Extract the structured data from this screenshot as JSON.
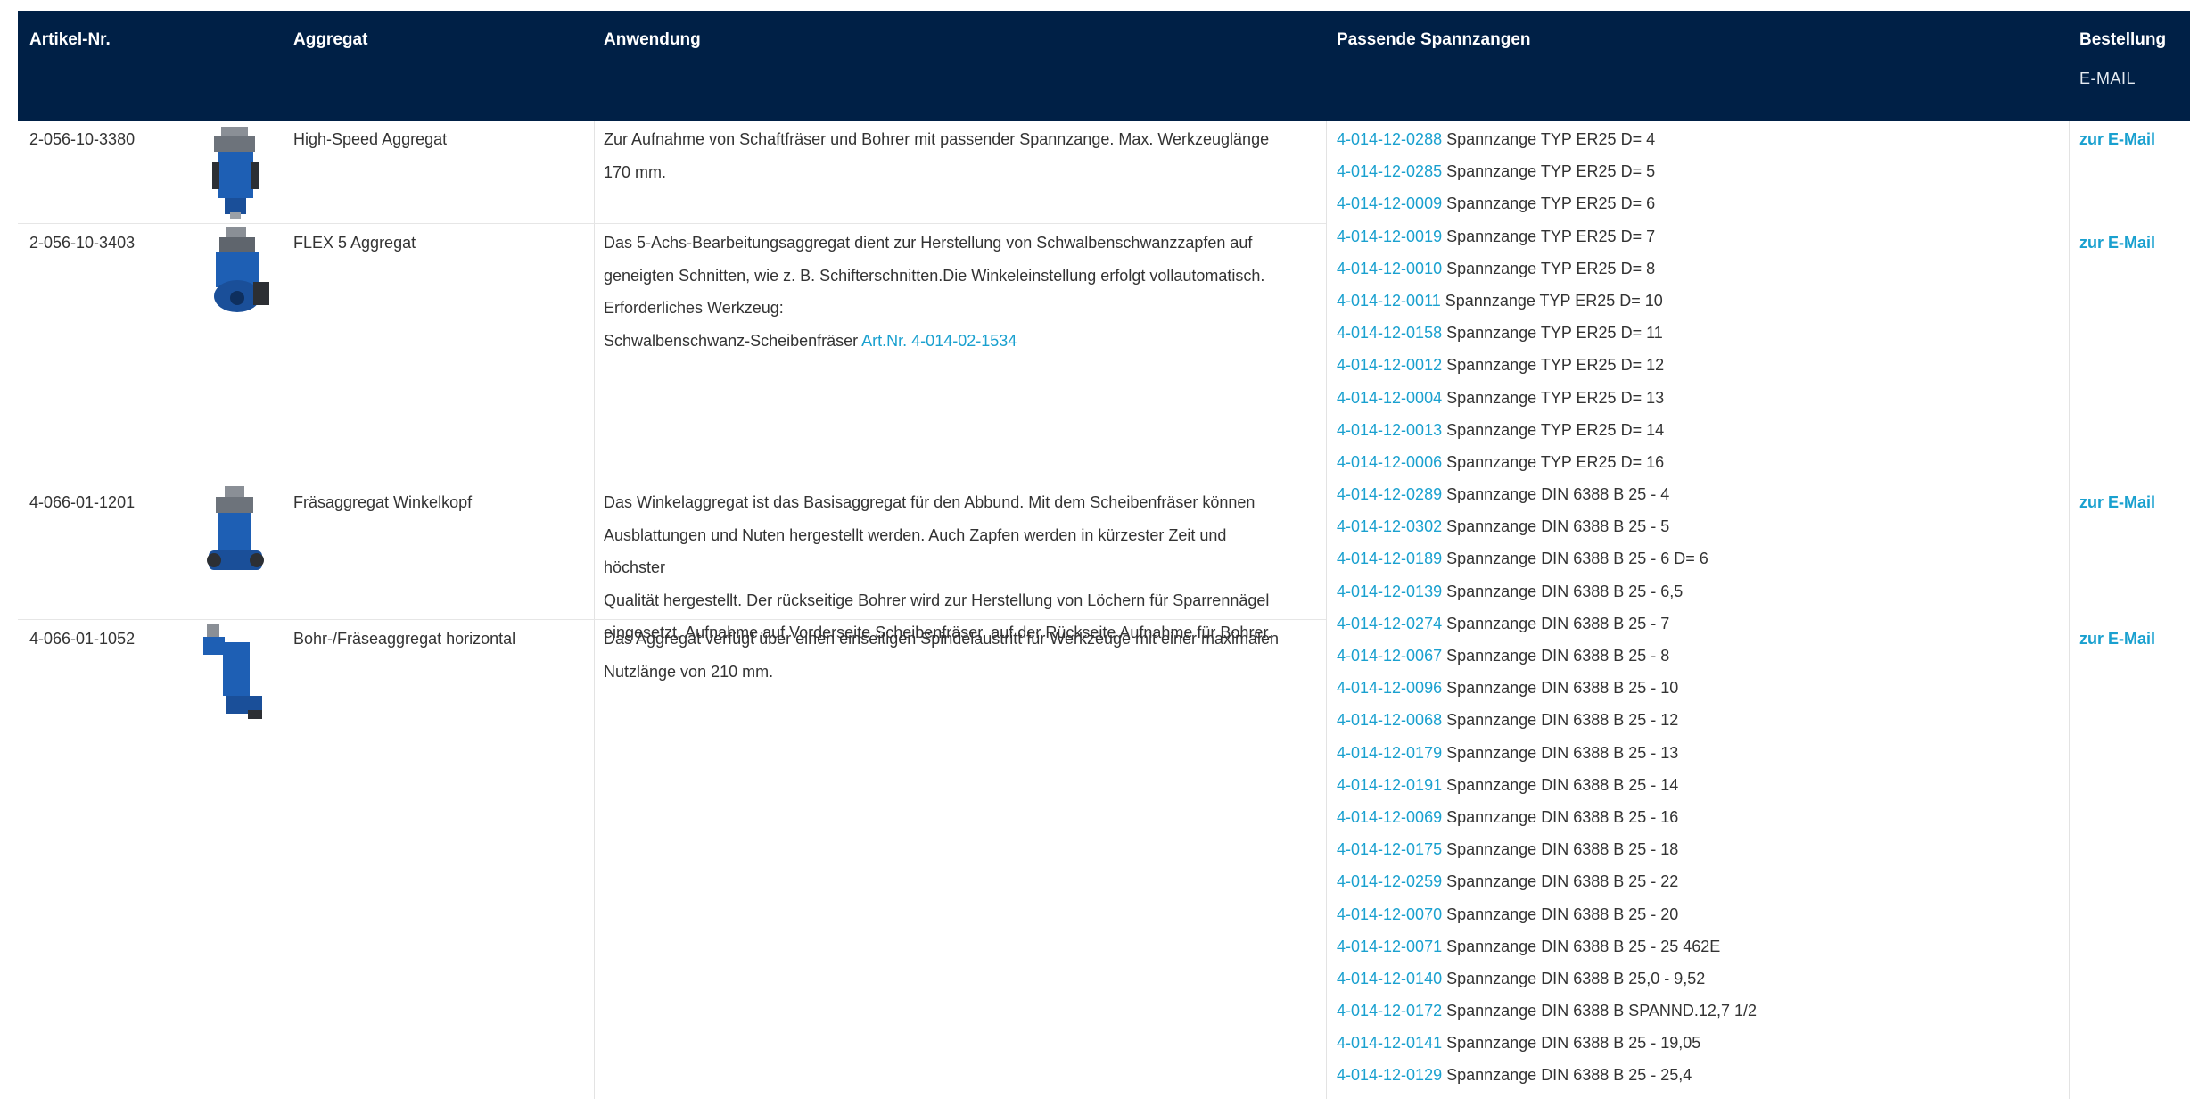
{
  "table": {
    "headers": {
      "artikel": "Artikel-Nr.",
      "aggregat": "Aggregat",
      "anwendung": "Anwendung",
      "spannzangen": "Passende Spannzangen",
      "bestellung": "Bestellung",
      "bestellung_sub": "E-MAIL"
    },
    "rows": [
      {
        "artikel": "2-056-10-3380",
        "image_icon": "aggregate-photo-icon",
        "aggregat": "High-Speed Aggregat",
        "anwendung": [
          "Zur Aufnahme von Schaftfräser und Bohrer mit passender Spannzange. Max. Werkzeuglänge",
          "170 mm."
        ],
        "email": "zur E-Mail"
      },
      {
        "artikel": "2-056-10-3403",
        "image_icon": "aggregate-photo-icon",
        "aggregat": "FLEX 5 Aggregat",
        "anwendung": [
          "Das 5-Achs-Bearbeitungsaggregat dient zur Herstellung von Schwalbenschwanzzapfen auf",
          "geneigten Schnitten, wie z. B. Schifterschnitten.Die Winkeleinstellung erfolgt vollautomatisch.",
          "Erforderliches Werkzeug:"
        ],
        "anwendung_last_prefix": "Schwalbenschwanz-Scheibenfräser ",
        "anwendung_link": "Art.Nr. 4-014-02-1534",
        "email": "zur E-Mail"
      },
      {
        "artikel": "4-066-01-1201",
        "image_icon": "aggregate-photo-icon",
        "aggregat": "Fräsaggregat Winkelkopf",
        "anwendung": [
          "Das Winkelaggregat ist das Basisaggregat für den Abbund. Mit dem Scheibenfräser können",
          "Ausblattungen und Nuten hergestellt werden. Auch Zapfen werden in kürzester Zeit und höchster",
          "Qualität hergestellt. Der rückseitige Bohrer wird zur Herstellung von Löchern für Sparrennägel",
          "eingesetzt. Aufnahme auf Vorderseite Scheibenfräser, auf der Rückseite Aufnahme für Bohrer."
        ],
        "email": "zur E-Mail"
      },
      {
        "artikel": "4-066-01-1052",
        "image_icon": "aggregate-photo-icon",
        "aggregat": "Bohr-/Fräseaggregat horizontal",
        "anwendung": [
          "Das Aggregat verfügt über einen einseitigen Spindelaustritt für Werkzeuge mit einer maximalen",
          "Nutzlänge von 210 mm."
        ],
        "email": "zur E-Mail"
      }
    ],
    "clamps": [
      {
        "code": "4-014-12-0288",
        "label": " Spannzange TYP ER25 D= 4"
      },
      {
        "code": "4-014-12-0285",
        "label": " Spannzange TYP ER25 D= 5"
      },
      {
        "code": "4-014-12-0009",
        "label": " Spannzange TYP ER25 D= 6"
      },
      {
        "code": "4-014-12-0019",
        "label": " Spannzange TYP ER25 D= 7"
      },
      {
        "code": "4-014-12-0010",
        "label": " Spannzange TYP ER25 D= 8"
      },
      {
        "code": "4-014-12-0011",
        "label": " Spannzange TYP ER25 D= 10"
      },
      {
        "code": "4-014-12-0158",
        "label": " Spannzange TYP ER25 D= 11"
      },
      {
        "code": "4-014-12-0012",
        "label": " Spannzange TYP ER25 D= 12"
      },
      {
        "code": "4-014-12-0004",
        "label": " Spannzange TYP ER25 D= 13"
      },
      {
        "code": "4-014-12-0013",
        "label": " Spannzange TYP ER25 D= 14"
      },
      {
        "code": "4-014-12-0006",
        "label": " Spannzange TYP ER25 D= 16"
      },
      {
        "code": "4-014-12-0289",
        "label": " Spannzange DIN 6388 B 25 - 4"
      },
      {
        "code": "4-014-12-0302",
        "label": " Spannzange DIN 6388 B 25 - 5"
      },
      {
        "code": "4-014-12-0189",
        "label": " Spannzange DIN 6388 B 25 - 6 D= 6"
      },
      {
        "code": "4-014-12-0139",
        "label": " Spannzange DIN 6388 B 25 - 6,5"
      },
      {
        "code": "4-014-12-0274",
        "label": " Spannzange DIN 6388 B 25 - 7"
      },
      {
        "code": "4-014-12-0067",
        "label": " Spannzange DIN 6388 B 25 - 8"
      },
      {
        "code": "4-014-12-0096",
        "label": " Spannzange DIN 6388 B 25 - 10"
      },
      {
        "code": "4-014-12-0068",
        "label": " Spannzange DIN 6388 B 25 - 12"
      },
      {
        "code": "4-014-12-0179",
        "label": " Spannzange DIN 6388 B 25 - 13"
      },
      {
        "code": "4-014-12-0191",
        "label": " Spannzange DIN 6388 B 25 - 14"
      },
      {
        "code": "4-014-12-0069",
        "label": " Spannzange DIN 6388 B 25 - 16"
      },
      {
        "code": "4-014-12-0175",
        "label": " Spannzange DIN 6388 B 25 - 18"
      },
      {
        "code": "4-014-12-0259",
        "label": " Spannzange DIN 6388 B 25 - 22"
      },
      {
        "code": "4-014-12-0070",
        "label": " Spannzange DIN 6388 B 25 - 20"
      },
      {
        "code": "4-014-12-0071",
        "label": " Spannzange DIN 6388 B 25 - 25 462E"
      },
      {
        "code": "4-014-12-0140",
        "label": " Spannzange DIN 6388 B 25,0 - 9,52"
      },
      {
        "code": "4-014-12-0172",
        "label": " Spannzange DIN 6388 B SPANND.12,7 1/2"
      },
      {
        "code": "4-014-12-0141",
        "label": " Spannzange DIN 6388 B 25 - 19,05"
      },
      {
        "code": "4-014-12-0129",
        "label": " Spannzange DIN 6388 B 25 - 25,4"
      }
    ]
  },
  "colors": {
    "header_bg": "#002046",
    "link": "#19a0cf",
    "aggregate_blue": "#1e5fb4"
  }
}
